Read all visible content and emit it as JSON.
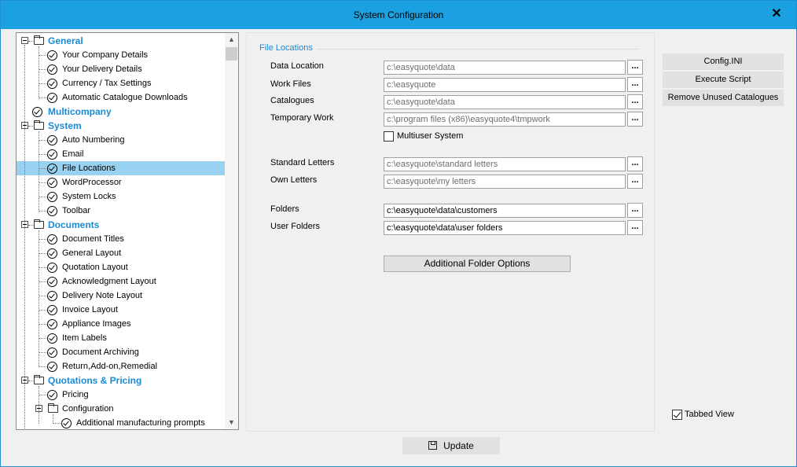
{
  "window": {
    "title": "System Configuration"
  },
  "tree": [
    {
      "label": "General",
      "category": true,
      "expanded": true
    },
    {
      "label": "Your Company Details"
    },
    {
      "label": "Your Delivery Details"
    },
    {
      "label": "Currency / Tax Settings"
    },
    {
      "label": "Automatic Catalogue Downloads"
    },
    {
      "label": "Multicompany",
      "category": true,
      "leaf": true
    },
    {
      "label": "System",
      "category": true,
      "expanded": true
    },
    {
      "label": "Auto Numbering"
    },
    {
      "label": "Email"
    },
    {
      "label": "File Locations",
      "selected": true
    },
    {
      "label": "WordProcessor"
    },
    {
      "label": "System Locks"
    },
    {
      "label": "Toolbar"
    },
    {
      "label": "Documents",
      "category": true,
      "expanded": true
    },
    {
      "label": "Document Titles"
    },
    {
      "label": "General Layout"
    },
    {
      "label": "Quotation Layout"
    },
    {
      "label": "Acknowledgment Layout"
    },
    {
      "label": "Delivery Note Layout"
    },
    {
      "label": "Invoice Layout"
    },
    {
      "label": "Appliance Images"
    },
    {
      "label": "Item Labels"
    },
    {
      "label": "Document Archiving"
    },
    {
      "label": "Return,Add-on,Remedial"
    },
    {
      "label": "Quotations & Pricing",
      "category": true,
      "expanded": true
    },
    {
      "label": "Pricing"
    },
    {
      "label": "Configuration",
      "subfolder": true
    },
    {
      "label": "Additional manufacturing prompts",
      "nested": true
    }
  ],
  "panel": {
    "group_title": "File Locations",
    "fields": {
      "data_location": {
        "label": "Data Location",
        "value": "c:\\easyquote\\data"
      },
      "work_files": {
        "label": "Work Files",
        "value": "c:\\easyquote"
      },
      "catalogues": {
        "label": "Catalogues",
        "value": "c:\\easyquote\\data"
      },
      "temporary_work": {
        "label": "Temporary Work",
        "value": "c:\\program files (x86)\\easyquote4\\tmpwork"
      },
      "standard_letters": {
        "label": "Standard Letters",
        "value": "c:\\easyquote\\standard letters"
      },
      "own_letters": {
        "label": "Own Letters",
        "value": "c:\\easyquote\\my letters"
      },
      "folders": {
        "label": "Folders",
        "value": "c:\\easyquote\\data\\customers"
      },
      "user_folders": {
        "label": "User Folders",
        "value": "c:\\easyquote\\data\\user folders"
      }
    },
    "browse_label": "...",
    "multiuser_label": "Multiuser System",
    "multiuser_checked": false,
    "additional_folder_options": "Additional Folder Options"
  },
  "side_buttons": {
    "config_ini": "Config.INI",
    "execute_script": "Execute Script",
    "remove_unused": "Remove Unused Catalogues"
  },
  "tabbed_view": {
    "label": "Tabbed View",
    "checked": true
  },
  "update_label": "Update",
  "colors": {
    "titlebar": "#1ba1e2",
    "category_text": "#1a8ad4",
    "selection": "#99d1f1"
  }
}
